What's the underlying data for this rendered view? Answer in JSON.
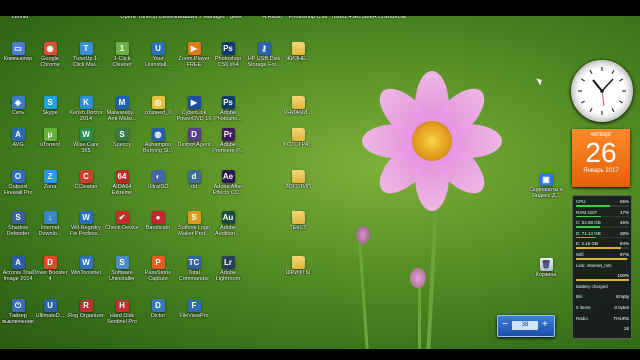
{
  "top_labels": [
    "Leonid",
    "",
    "",
    "Opera",
    "TuneUp Utilities 2012",
    "Windows 7 Manager",
    "geek",
    "H.Radio",
    "Photoshop CS6",
    "rufus1.4.8",
    "МУЗЫКА СЛИШКОМ"
  ],
  "icons": [
    {
      "label": "Компьютер",
      "color": "#4a7fd0",
      "glyph": "▭",
      "folder": false
    },
    {
      "label": "Google Chrome",
      "color": "#dd4b39",
      "glyph": "◉",
      "folder": false
    },
    {
      "label": "TuneUp 1-Click Mai...",
      "color": "#3a8ed8",
      "glyph": "T",
      "folder": false
    },
    {
      "label": "1-Click Cleaner",
      "color": "#6ab04c",
      "glyph": "1",
      "folder": false
    },
    {
      "label": "Your Uninstall...",
      "color": "#2a6fb5",
      "glyph": "U",
      "folder": false
    },
    {
      "label": "Zoom Player FREE",
      "color": "#e07b1a",
      "glyph": "▶",
      "folder": false
    },
    {
      "label": "Photoshop CS6 x64",
      "color": "#0d3a6e",
      "glyph": "Ps",
      "folder": false
    },
    {
      "label": "HP USB Disk Storage For...",
      "color": "#2d62b3",
      "glyph": "⚷",
      "folder": false
    },
    {
      "label": "ЖИЗНЕ...",
      "color": "#e7b640",
      "glyph": "",
      "folder": true
    },
    {
      "label": "Сеть",
      "color": "#3d7ac8",
      "glyph": "◈",
      "folder": false
    },
    {
      "label": "Skype",
      "color": "#1aa6e0",
      "glyph": "S",
      "folder": false
    },
    {
      "label": "Kerish Doctor 2014",
      "color": "#2e8fd6",
      "glyph": "K",
      "folder": false
    },
    {
      "label": "Malwareby... Anti-Malw...",
      "color": "#1d5fb3",
      "glyph": "M",
      "folder": false
    },
    {
      "label": "cdspeed_0",
      "color": "#e8c23c",
      "glyph": "◎",
      "folder": false
    },
    {
      "label": "CyberLink PowerDVD 16",
      "color": "#1c4fa3",
      "glyph": "▶",
      "folder": false
    },
    {
      "label": "Adobe Photosho...",
      "color": "#0d3a6e",
      "glyph": "Ps",
      "folder": false
    },
    {
      "label": "",
      "color": "#000000",
      "glyph": "",
      "folder": false
    },
    {
      "label": "КНИЖКИ...",
      "color": "#e7b640",
      "glyph": "",
      "folder": true
    },
    {
      "label": "AVG",
      "color": "#2b6cb0",
      "glyph": "A",
      "folder": false
    },
    {
      "label": "uTorrent",
      "color": "#63b33a",
      "glyph": "μ",
      "folder": false
    },
    {
      "label": "Wise Care 365",
      "color": "#2a8e4f",
      "glyph": "W",
      "folder": false
    },
    {
      "label": "Speccy",
      "color": "#3a7a44",
      "glyph": "S",
      "folder": false
    },
    {
      "label": "Ashampoo Burning St...",
      "color": "#2a5fa8",
      "glyph": "◍",
      "folder": false
    },
    {
      "label": "Dexpot Agent",
      "color": "#5a3d8f",
      "glyph": "D",
      "folder": false
    },
    {
      "label": "Adobe Premiere P...",
      "color": "#3d1c59",
      "glyph": "Pr",
      "folder": false
    },
    {
      "label": "",
      "color": "#000000",
      "glyph": "",
      "folder": false
    },
    {
      "label": "ФОТОГРА...",
      "color": "#e7b640",
      "glyph": "",
      "folder": true
    },
    {
      "label": "Outpost Firewall Pro",
      "color": "#2f6db8",
      "glyph": "O",
      "folder": false
    },
    {
      "label": "Zona",
      "color": "#2b9be0",
      "glyph": "Z",
      "folder": false
    },
    {
      "label": "CCleaner",
      "color": "#c7412b",
      "glyph": "C",
      "folder": false
    },
    {
      "label": "AIDA64 Extreme",
      "color": "#b92a2a",
      "glyph": "64",
      "folder": false
    },
    {
      "label": "UltraISO",
      "color": "#4466a8",
      "glyph": "◐",
      "folder": false
    },
    {
      "label": "dd",
      "color": "#3a6e8f",
      "glyph": "d",
      "folder": false
    },
    {
      "label": "Adobe After Effects CC...",
      "color": "#2a1a4f",
      "glyph": "Ae",
      "folder": false
    },
    {
      "label": "",
      "color": "#000000",
      "glyph": "",
      "folder": false
    },
    {
      "label": "ЛОГОТИП",
      "color": "#e7b640",
      "glyph": "",
      "folder": true
    },
    {
      "label": "Shadow Defender",
      "color": "#3a5f9f",
      "glyph": "S",
      "folder": false
    },
    {
      "label": "Internet Downlo...",
      "color": "#3a86c8",
      "glyph": "↓",
      "folder": false
    },
    {
      "label": "Wit Registry Fix Profess...",
      "color": "#2a6ec4",
      "glyph": "W",
      "folder": false
    },
    {
      "label": "Check Device",
      "color": "#c62a2a",
      "glyph": "✔",
      "folder": false
    },
    {
      "label": "Bandicam",
      "color": "#c3262f",
      "glyph": "●",
      "folder": false
    },
    {
      "label": "Sothink Logo Maker Prof...",
      "color": "#e09a1c",
      "glyph": "S",
      "folder": false
    },
    {
      "label": "Adobe Audition ...",
      "color": "#1a4a3a",
      "glyph": "Au",
      "folder": false
    },
    {
      "label": "",
      "color": "#000000",
      "glyph": "",
      "folder": false
    },
    {
      "label": "ТЕКСТ",
      "color": "#e7b640",
      "glyph": "",
      "folder": true
    },
    {
      "label": "Acronis True Image 2014",
      "color": "#2a5ea8",
      "glyph": "A",
      "folder": false
    },
    {
      "label": "Driver Booster 4",
      "color": "#e34a2a",
      "glyph": "D",
      "folder": false
    },
    {
      "label": "WinToolsnet",
      "color": "#2d73c0",
      "glyph": "W",
      "folder": false
    },
    {
      "label": "Software Uninstaller",
      "color": "#4c8ec6",
      "glyph": "S",
      "folder": false
    },
    {
      "label": "PassStone Capture",
      "color": "#e85c1f",
      "glyph": "P",
      "folder": false
    },
    {
      "label": "Total Commander",
      "color": "#3361a8",
      "glyph": "TC",
      "folder": false
    },
    {
      "label": "Adobe Lightroom",
      "color": "#2a3e59",
      "glyph": "Lr",
      "folder": false
    },
    {
      "label": "",
      "color": "#000000",
      "glyph": "",
      "folder": false
    },
    {
      "label": "ШРИФТЫ",
      "color": "#e7b640",
      "glyph": "",
      "folder": true
    },
    {
      "label": "Тайкер выключения",
      "color": "#3a6fb8",
      "glyph": "⏻",
      "folder": false
    },
    {
      "label": "UltimateD...",
      "color": "#2a63a8",
      "glyph": "U",
      "folder": false
    },
    {
      "label": "Reg Organizer",
      "color": "#b83232",
      "glyph": "R",
      "folder": false
    },
    {
      "label": "Hard Disk Sentinel Pro",
      "color": "#c43030",
      "glyph": "H",
      "folder": false
    },
    {
      "label": "Dictor",
      "color": "#3a7ab8",
      "glyph": "D",
      "folder": false
    },
    {
      "label": "FileViewPro",
      "color": "#2f6cb8",
      "glyph": "F",
      "folder": false
    }
  ],
  "recycle_bin": "Корзина",
  "yandex_screenshots": "Скриншоты в Яндекс.Д...",
  "calendar": {
    "weekday": "четверг",
    "day": "26",
    "month_year": "Январь 2017"
  },
  "sysmon": [
    {
      "k": "CPU",
      "v": "65%",
      "pct": 0.65
    },
    {
      "k": "RAM 3187",
      "v": "47%",
      "pct": 0.47
    },
    {
      "k": "C: 54.58 GB",
      "v": "46%",
      "pct": 0.46
    },
    {
      "k": "D: 71.14 GB",
      "v": "38%",
      "pct": 0.38
    },
    {
      "k": "E: 2.18 GB",
      "v": "84%",
      "pct": 0.84
    },
    {
      "k": "Wifi",
      "v": "97%",
      "pct": 0.97
    },
    {
      "k": "Link: internet_mts",
      "v": "",
      "pct": 0
    },
    {
      "k": "",
      "v": "100%",
      "pct": 1.0
    },
    {
      "k": "Battery charged",
      "v": "",
      "pct": 0
    },
    {
      "k": "Bin",
      "v": "Empty",
      "pct": 0
    },
    {
      "k": "0 items",
      "v": "0 bytes",
      "pct": 0
    },
    {
      "k": "Radio",
      "v": "THURS",
      "pct": 0
    },
    {
      "k": "",
      "v": "26",
      "pct": 0
    }
  ],
  "volume": {
    "value": "38"
  }
}
